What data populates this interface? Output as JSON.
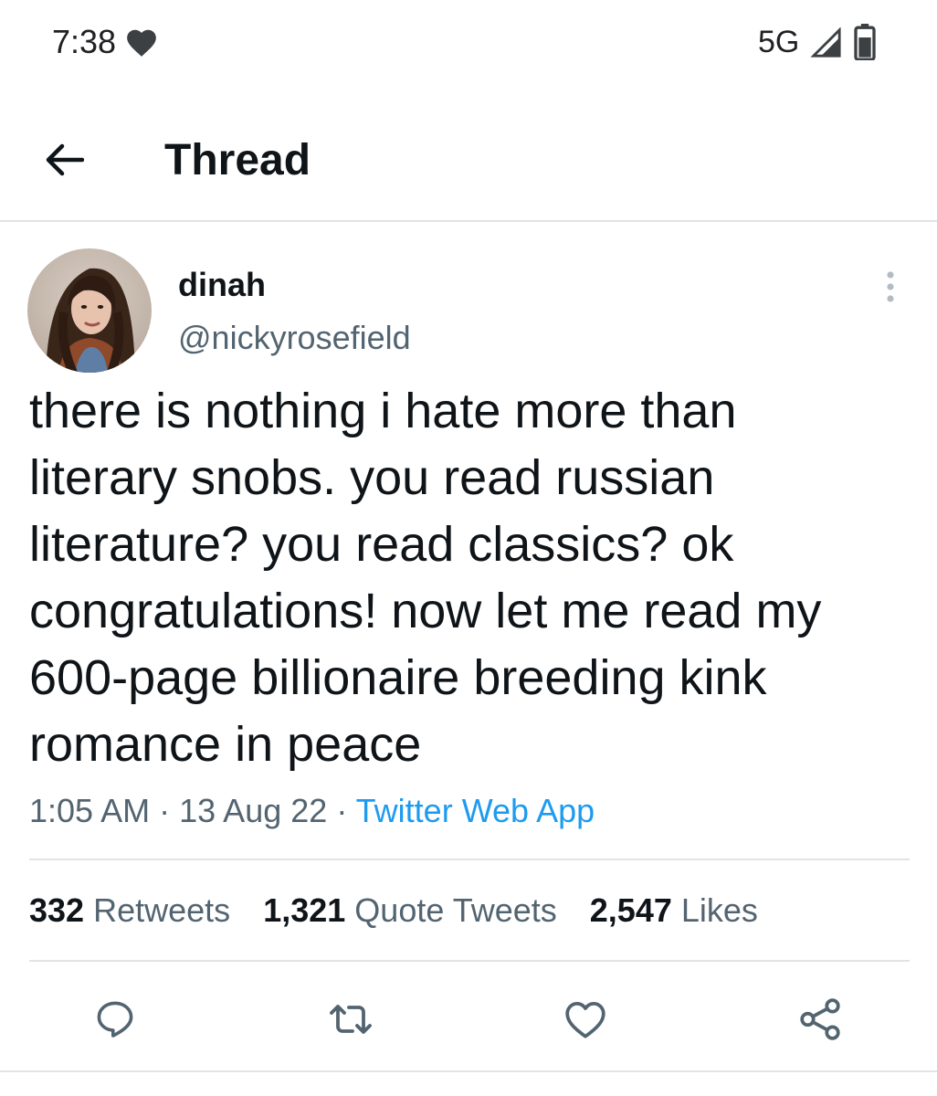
{
  "status_bar": {
    "time": "7:38",
    "network": "5G",
    "icons": [
      "heart-icon",
      "signal-icon",
      "battery-icon"
    ]
  },
  "header": {
    "title": "Thread",
    "back_icon": "arrow-left-icon"
  },
  "tweet": {
    "display_name": "dinah",
    "handle": "@nickyrosefield",
    "text_lines": [
      "there is nothing i hate more than",
      "literary snobs. you read russian",
      "literature? you read classics? ok",
      "congratulations! now let me read my",
      "600-page billionaire breeding kink",
      "romance in peace"
    ],
    "time": "1:05 AM",
    "date": "13 Aug 22",
    "separator": "·",
    "source": "Twitter Web App",
    "stats": {
      "retweets_count": "332",
      "retweets_label": "Retweets",
      "quotes_count": "1,321",
      "quotes_label": "Quote Tweets",
      "likes_count": "2,547",
      "likes_label": "Likes"
    },
    "actions": [
      "reply-icon",
      "retweet-icon",
      "like-icon",
      "share-icon"
    ]
  },
  "colors": {
    "text_primary": "#0f1419",
    "text_secondary": "#536471",
    "link": "#1d9bf0",
    "divider": "#e1e4e6"
  }
}
